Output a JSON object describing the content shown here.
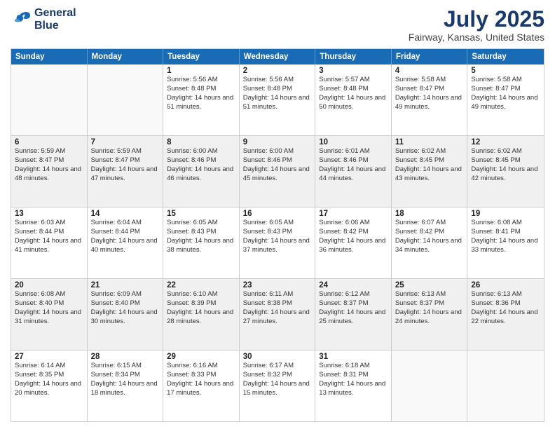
{
  "header": {
    "logo": {
      "line1": "General",
      "line2": "Blue"
    },
    "title": "July 2025",
    "subtitle": "Fairway, Kansas, United States"
  },
  "calendar": {
    "days": [
      "Sunday",
      "Monday",
      "Tuesday",
      "Wednesday",
      "Thursday",
      "Friday",
      "Saturday"
    ],
    "rows": [
      [
        {
          "day": "",
          "empty": true
        },
        {
          "day": "",
          "empty": true
        },
        {
          "day": "1",
          "sunrise": "Sunrise: 5:56 AM",
          "sunset": "Sunset: 8:48 PM",
          "daylight": "Daylight: 14 hours and 51 minutes."
        },
        {
          "day": "2",
          "sunrise": "Sunrise: 5:56 AM",
          "sunset": "Sunset: 8:48 PM",
          "daylight": "Daylight: 14 hours and 51 minutes."
        },
        {
          "day": "3",
          "sunrise": "Sunrise: 5:57 AM",
          "sunset": "Sunset: 8:48 PM",
          "daylight": "Daylight: 14 hours and 50 minutes."
        },
        {
          "day": "4",
          "sunrise": "Sunrise: 5:58 AM",
          "sunset": "Sunset: 8:47 PM",
          "daylight": "Daylight: 14 hours and 49 minutes."
        },
        {
          "day": "5",
          "sunrise": "Sunrise: 5:58 AM",
          "sunset": "Sunset: 8:47 PM",
          "daylight": "Daylight: 14 hours and 49 minutes."
        }
      ],
      [
        {
          "day": "6",
          "sunrise": "Sunrise: 5:59 AM",
          "sunset": "Sunset: 8:47 PM",
          "daylight": "Daylight: 14 hours and 48 minutes."
        },
        {
          "day": "7",
          "sunrise": "Sunrise: 5:59 AM",
          "sunset": "Sunset: 8:47 PM",
          "daylight": "Daylight: 14 hours and 47 minutes."
        },
        {
          "day": "8",
          "sunrise": "Sunrise: 6:00 AM",
          "sunset": "Sunset: 8:46 PM",
          "daylight": "Daylight: 14 hours and 46 minutes."
        },
        {
          "day": "9",
          "sunrise": "Sunrise: 6:00 AM",
          "sunset": "Sunset: 8:46 PM",
          "daylight": "Daylight: 14 hours and 45 minutes."
        },
        {
          "day": "10",
          "sunrise": "Sunrise: 6:01 AM",
          "sunset": "Sunset: 8:46 PM",
          "daylight": "Daylight: 14 hours and 44 minutes."
        },
        {
          "day": "11",
          "sunrise": "Sunrise: 6:02 AM",
          "sunset": "Sunset: 8:45 PM",
          "daylight": "Daylight: 14 hours and 43 minutes."
        },
        {
          "day": "12",
          "sunrise": "Sunrise: 6:02 AM",
          "sunset": "Sunset: 8:45 PM",
          "daylight": "Daylight: 14 hours and 42 minutes."
        }
      ],
      [
        {
          "day": "13",
          "sunrise": "Sunrise: 6:03 AM",
          "sunset": "Sunset: 8:44 PM",
          "daylight": "Daylight: 14 hours and 41 minutes."
        },
        {
          "day": "14",
          "sunrise": "Sunrise: 6:04 AM",
          "sunset": "Sunset: 8:44 PM",
          "daylight": "Daylight: 14 hours and 40 minutes."
        },
        {
          "day": "15",
          "sunrise": "Sunrise: 6:05 AM",
          "sunset": "Sunset: 8:43 PM",
          "daylight": "Daylight: 14 hours and 38 minutes."
        },
        {
          "day": "16",
          "sunrise": "Sunrise: 6:05 AM",
          "sunset": "Sunset: 8:43 PM",
          "daylight": "Daylight: 14 hours and 37 minutes."
        },
        {
          "day": "17",
          "sunrise": "Sunrise: 6:06 AM",
          "sunset": "Sunset: 8:42 PM",
          "daylight": "Daylight: 14 hours and 36 minutes."
        },
        {
          "day": "18",
          "sunrise": "Sunrise: 6:07 AM",
          "sunset": "Sunset: 8:42 PM",
          "daylight": "Daylight: 14 hours and 34 minutes."
        },
        {
          "day": "19",
          "sunrise": "Sunrise: 6:08 AM",
          "sunset": "Sunset: 8:41 PM",
          "daylight": "Daylight: 14 hours and 33 minutes."
        }
      ],
      [
        {
          "day": "20",
          "sunrise": "Sunrise: 6:08 AM",
          "sunset": "Sunset: 8:40 PM",
          "daylight": "Daylight: 14 hours and 31 minutes."
        },
        {
          "day": "21",
          "sunrise": "Sunrise: 6:09 AM",
          "sunset": "Sunset: 8:40 PM",
          "daylight": "Daylight: 14 hours and 30 minutes."
        },
        {
          "day": "22",
          "sunrise": "Sunrise: 6:10 AM",
          "sunset": "Sunset: 8:39 PM",
          "daylight": "Daylight: 14 hours and 28 minutes."
        },
        {
          "day": "23",
          "sunrise": "Sunrise: 6:11 AM",
          "sunset": "Sunset: 8:38 PM",
          "daylight": "Daylight: 14 hours and 27 minutes."
        },
        {
          "day": "24",
          "sunrise": "Sunrise: 6:12 AM",
          "sunset": "Sunset: 8:37 PM",
          "daylight": "Daylight: 14 hours and 25 minutes."
        },
        {
          "day": "25",
          "sunrise": "Sunrise: 6:13 AM",
          "sunset": "Sunset: 8:37 PM",
          "daylight": "Daylight: 14 hours and 24 minutes."
        },
        {
          "day": "26",
          "sunrise": "Sunrise: 6:13 AM",
          "sunset": "Sunset: 8:36 PM",
          "daylight": "Daylight: 14 hours and 22 minutes."
        }
      ],
      [
        {
          "day": "27",
          "sunrise": "Sunrise: 6:14 AM",
          "sunset": "Sunset: 8:35 PM",
          "daylight": "Daylight: 14 hours and 20 minutes."
        },
        {
          "day": "28",
          "sunrise": "Sunrise: 6:15 AM",
          "sunset": "Sunset: 8:34 PM",
          "daylight": "Daylight: 14 hours and 18 minutes."
        },
        {
          "day": "29",
          "sunrise": "Sunrise: 6:16 AM",
          "sunset": "Sunset: 8:33 PM",
          "daylight": "Daylight: 14 hours and 17 minutes."
        },
        {
          "day": "30",
          "sunrise": "Sunrise: 6:17 AM",
          "sunset": "Sunset: 8:32 PM",
          "daylight": "Daylight: 14 hours and 15 minutes."
        },
        {
          "day": "31",
          "sunrise": "Sunrise: 6:18 AM",
          "sunset": "Sunset: 8:31 PM",
          "daylight": "Daylight: 14 hours and 13 minutes."
        },
        {
          "day": "",
          "empty": true
        },
        {
          "day": "",
          "empty": true
        }
      ]
    ]
  }
}
